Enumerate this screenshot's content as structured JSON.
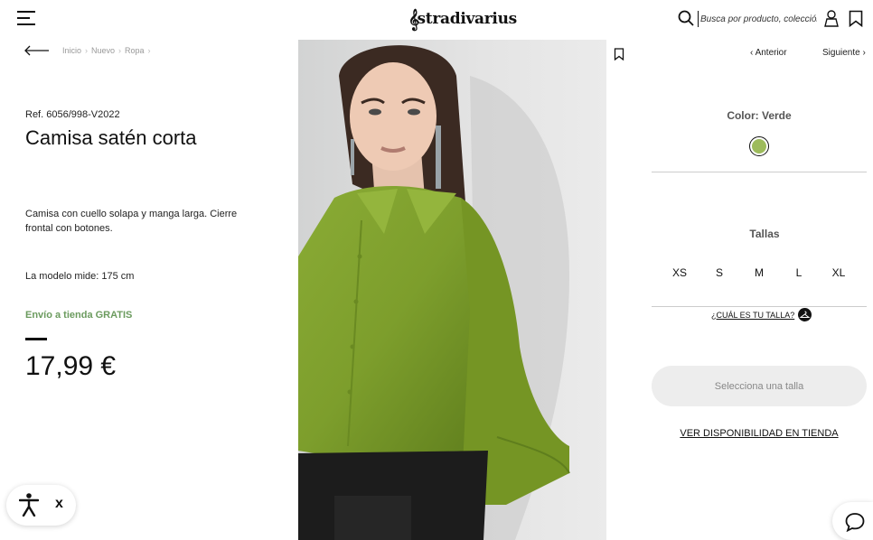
{
  "header": {
    "logo_text": "stradivarius",
    "search_placeholder": "Busca por producto, colección..."
  },
  "breadcrumb": [
    "Inicio",
    "Nuevo",
    "Ropa"
  ],
  "product": {
    "ref": "Ref. 6056/998-V2022",
    "title": "Camisa satén corta",
    "description": "Camisa con cuello solapa y manga larga. Cierre frontal con botones.",
    "model_info": "La modelo mide: 175 cm",
    "shipping": "Envío a tienda GRATIS",
    "price": "17,99 €"
  },
  "nav": {
    "prev_label": "Anterior",
    "next_label": "Siguiente"
  },
  "color": {
    "label": "Color: Verde",
    "swatch_hex": "#9dbb5c"
  },
  "sizes": {
    "label": "Tallas",
    "options": [
      "XS",
      "S",
      "M",
      "L",
      "XL"
    ],
    "guide_label": "¿CUÁL ES TU TALLA?"
  },
  "actions": {
    "select_size_label": "Selecciona una talla",
    "availability_label": "VER DISPONIBILIDAD EN TIENDA"
  },
  "accessibility_widget": {
    "close_label": "x"
  },
  "colors": {
    "shipping_green": "#6b9b5e",
    "shirt_green": "#7d9e2c"
  }
}
